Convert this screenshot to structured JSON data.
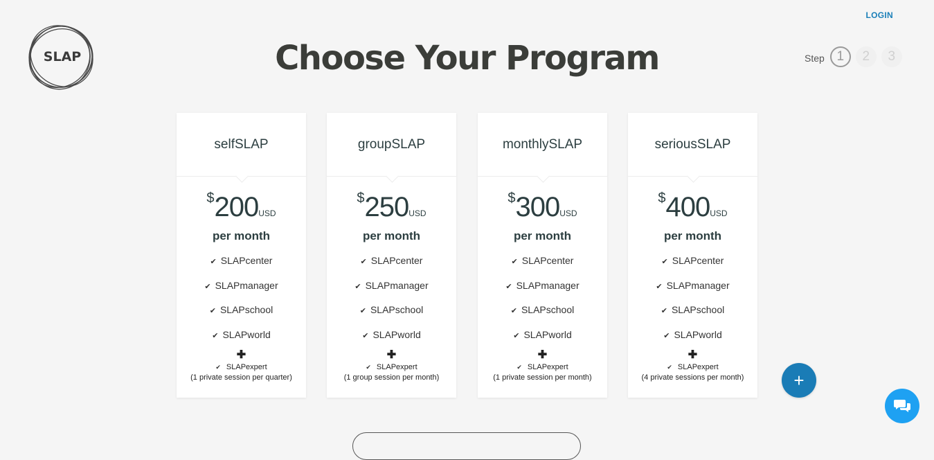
{
  "header": {
    "logo_text": "SLAP",
    "login_label": "LOGIN",
    "title": "Choose Your Program"
  },
  "steps": {
    "label": "Step",
    "items": [
      "1",
      "2",
      "3"
    ],
    "active": "1"
  },
  "plans": [
    {
      "name": "selfSLAP",
      "currency": "$",
      "price": "200",
      "unit": "USD",
      "period": "per month",
      "features": [
        "SLAPcenter",
        "SLAPmanager",
        "SLAPschool",
        "SLAPworld"
      ],
      "plus": "✚",
      "expert": "SLAPexpert",
      "expert_note": "(1 private session per quarter)"
    },
    {
      "name": "groupSLAP",
      "currency": "$",
      "price": "250",
      "unit": "USD",
      "period": "per month",
      "features": [
        "SLAPcenter",
        "SLAPmanager",
        "SLAPschool",
        "SLAPworld"
      ],
      "plus": "✚",
      "expert": "SLAPexpert",
      "expert_note": "(1 group session per month)"
    },
    {
      "name": "monthlySLAP",
      "currency": "$",
      "price": "300",
      "unit": "USD",
      "period": "per month",
      "features": [
        "SLAPcenter",
        "SLAPmanager",
        "SLAPschool",
        "SLAPworld"
      ],
      "plus": "✚",
      "expert": "SLAPexpert",
      "expert_note": "(1 private session per month)"
    },
    {
      "name": "seriousSLAP",
      "currency": "$",
      "price": "400",
      "unit": "USD",
      "period": "per month",
      "features": [
        "SLAPcenter",
        "SLAPmanager",
        "SLAPschool",
        "SLAPworld"
      ],
      "plus": "✚",
      "expert": "SLAPexpert",
      "expert_note": "(4 private sessions per month)"
    }
  ],
  "icons": {
    "check": "✔",
    "fab": "+",
    "fab_icon": "plus-icon",
    "chat_icon": "chat-bubbles-icon"
  },
  "colors": {
    "accent": "#1a7cb6",
    "chat": "#1ea1f2",
    "login": "#1a7fb8",
    "title": "#3b3d39",
    "background": "#f5f5f5"
  }
}
